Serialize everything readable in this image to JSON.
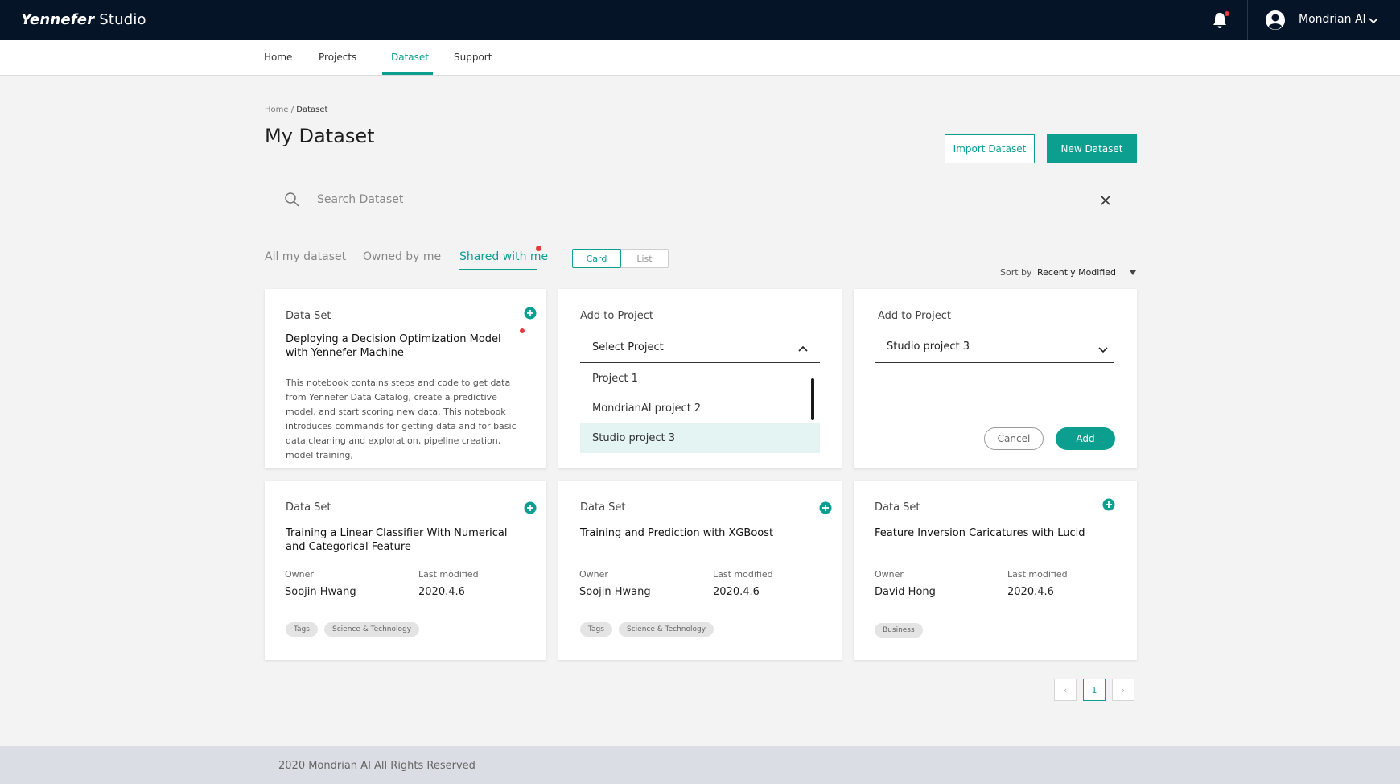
{
  "app": {
    "logo_script": "Yennefer",
    "logo_rest": "Studio"
  },
  "user": {
    "name": "Mondrian AI"
  },
  "nav": [
    {
      "label": "Home"
    },
    {
      "label": "Projects"
    },
    {
      "label": "Dataset"
    },
    {
      "label": "Support"
    }
  ],
  "breadcrumb": {
    "home": "Home",
    "separator": " / ",
    "current": "Dataset"
  },
  "page": {
    "title": "My Dataset"
  },
  "actions": {
    "import_label": "Import Dataset",
    "new_label": "New Dataset"
  },
  "search": {
    "placeholder": "Search Dataset",
    "value": ""
  },
  "filters": [
    {
      "label": "All my dataset"
    },
    {
      "label": "Owned by me"
    },
    {
      "label": "Shared with me"
    }
  ],
  "view_toggle": {
    "card": "Card",
    "list": "List"
  },
  "sort": {
    "label": "Sort by",
    "value": "Recently Modified"
  },
  "cards": {
    "c1": {
      "type": "Data Set",
      "title": "Deploying a Decision Optimization Model with Yennefer Machine",
      "description": "This notebook contains steps and code to get data from Yennefer Data Catalog, create a predictive model, and start scoring new data. This notebook introduces commands for getting data and for basic data cleaning and exploration, pipeline creation, model training,"
    },
    "c2": {
      "heading": "Add to Project",
      "select_value": "Select Project",
      "options": [
        "Project 1",
        "MondrianAI project 2",
        "Studio project 3"
      ]
    },
    "c3": {
      "heading": "Add to Project",
      "select_value": "Studio project 3",
      "cancel_label": "Cancel",
      "add_label": "Add"
    },
    "c4": {
      "type": "Data Set",
      "title": "Training a Linear Classifier With Numerical and Categorical Feature",
      "owner_label": "Owner",
      "owner": "Soojin Hwang",
      "modified_label": "Last modified",
      "modified": "2020.4.6",
      "tags": [
        "Tags",
        "Science & Technology"
      ]
    },
    "c5": {
      "type": "Data Set",
      "title": "Training and Prediction with XGBoost",
      "owner_label": "Owner",
      "owner": "Soojin Hwang",
      "modified_label": "Last modified",
      "modified": "2020.4.6",
      "tags": [
        "Tags",
        "Science & Technology"
      ]
    },
    "c6": {
      "type": "Data Set",
      "title": "Feature Inversion Caricatures with Lucid",
      "owner_label": "Owner",
      "owner": "David Hong",
      "modified_label": "Last modified",
      "modified": "2020.4.6",
      "tags": [
        "Business"
      ]
    }
  },
  "pagination": {
    "prev": "‹",
    "current": "1",
    "next": "›"
  },
  "footer": {
    "text": "2020 Mondrian AI All Rights Reserved"
  },
  "icons": {
    "search": "search-icon",
    "close": "close-icon",
    "bell": "bell-icon",
    "avatar": "user-avatar-icon",
    "chevron_down": "chevron-down-icon",
    "chevron_up": "chevron-up-icon",
    "plus": "plus-circle-icon"
  },
  "colors": {
    "brand": "#0c9f8f",
    "header_bg": "#061428",
    "notification": "#e5393d",
    "page_bg": "#f3f3f4",
    "footer_bg": "#dadde3",
    "option_selected": "#e3f4f2"
  }
}
